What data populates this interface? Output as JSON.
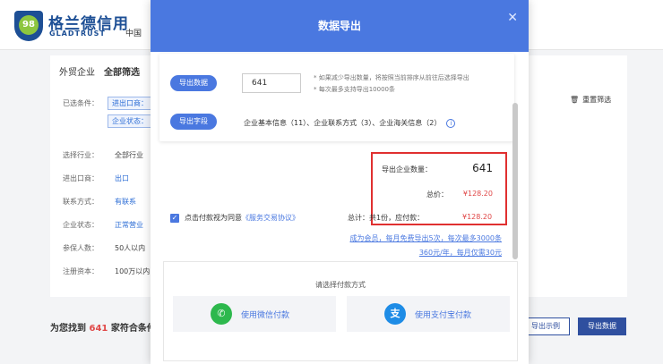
{
  "brand": {
    "name_cn": "格兰德信用",
    "name_en": "GLADTRUST",
    "region": "中国"
  },
  "background": {
    "tabs": [
      "外贸企业",
      "全部筛选"
    ],
    "conditions_label": "已选条件：",
    "condition_tags": [
      "进出口商：",
      "企业状态："
    ],
    "reset_label": "重置筛选",
    "filters": [
      {
        "label": "选择行业：",
        "value": "全部行业"
      },
      {
        "label": "进出口商：",
        "value": "出口"
      },
      {
        "label": "联系方式：",
        "value": "有联系"
      },
      {
        "label": "企业状态：",
        "value": "正常营业"
      },
      {
        "label": "参保人数：",
        "value": "50人以内"
      },
      {
        "label": "注册资本：",
        "value": "100万以内"
      }
    ],
    "found_prefix": "为您找到",
    "found_count": "641",
    "found_suffix": "家符合条件",
    "example_button": "导出示例",
    "export_button": "导出数据"
  },
  "modal": {
    "title": "数据导出",
    "close_icon": "close-icon",
    "export_count_label": "导出数据",
    "export_count_value": "641",
    "note_line1": "* 如果减少导出数量，将按照当前排序从前往后选择导出",
    "note_line2": "* 每次最多支持导出10000条",
    "export_fields_label": "导出字段",
    "export_fields_text": "企业基本信息（11）、企业联系方式（3）、企业海关信息（2）",
    "summary": {
      "count_label": "导出企业数量：",
      "count_value": "641",
      "price_label": "总价：",
      "price_value": "¥128.20"
    },
    "agree_text": "点击付款视为同意",
    "agreement_link": "《服务交易协议》",
    "total_label": "总计：共1份，应付款：",
    "total_value": "¥128.20",
    "promo_line1": "成为会员，每月免费导出5次，每次最多3000条",
    "promo_line2": "360元/年，每月仅需30元",
    "payment_title": "请选择付款方式",
    "wechat_pay": "使用微信付款",
    "alipay": "使用支付宝付款"
  },
  "colors": {
    "accent": "#4a78e0",
    "price": "#e04848",
    "highlight_border": "#e03030",
    "brand": "#1d4f95"
  }
}
